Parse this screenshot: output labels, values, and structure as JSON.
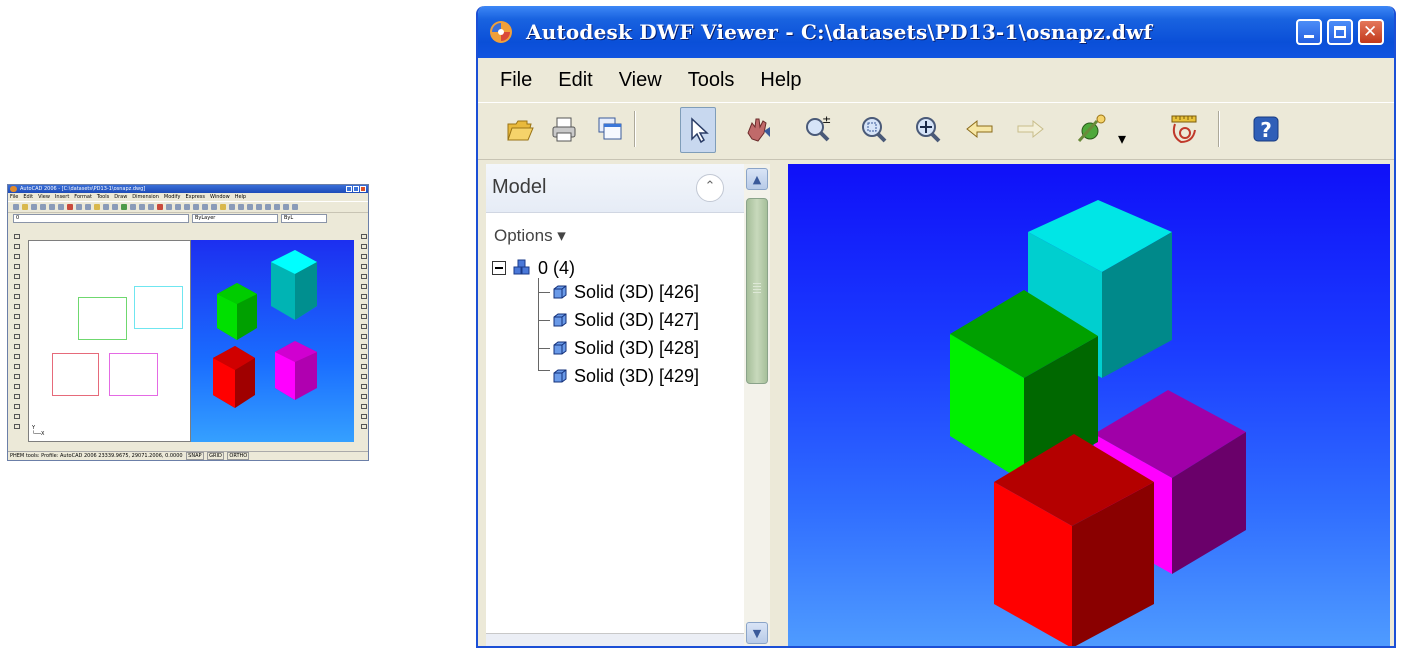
{
  "acad": {
    "title": "AutoCAD 2006 - [C:\\datasets\\PD13-1\\osnapz.dwg]",
    "menu": [
      "File",
      "Edit",
      "View",
      "Insert",
      "Format",
      "Tools",
      "Draw",
      "Dimension",
      "Modify",
      "Express",
      "Window",
      "Help"
    ],
    "layer_value": "0",
    "color_value": "ByLayer",
    "linetype_value": "ByL",
    "status_text": "PHEM tools: Profile: AutoCAD 2006  23339.9675, 29071.2006, 0.0000",
    "status_toggles": [
      "SNAP",
      "GRID",
      "ORTHO"
    ]
  },
  "window": {
    "title": "Autodesk DWF Viewer - C:\\datasets\\PD13-1\\osnapz.dwf"
  },
  "menu": [
    "File",
    "Edit",
    "View",
    "Tools",
    "Help"
  ],
  "toolbar": [
    {
      "icon": "open-folder-icon"
    },
    {
      "icon": "print-icon"
    },
    {
      "icon": "copy-icon"
    },
    {
      "icon": "select-arrow-icon"
    },
    {
      "icon": "pan-hand-icon"
    },
    {
      "icon": "zoom-icon"
    },
    {
      "icon": "zoom-rectangle-icon"
    },
    {
      "icon": "fit-to-window-icon"
    },
    {
      "icon": "back-arrow-icon"
    },
    {
      "icon": "forward-arrow-icon"
    },
    {
      "icon": "orbit-icon"
    },
    {
      "icon": "measure-icon"
    },
    {
      "icon": "help-icon"
    }
  ],
  "panel": {
    "title": "Model",
    "options_label": "Options ▾",
    "tree": {
      "root": "0 (4)",
      "children": [
        "Solid (3D) [426]",
        "Solid (3D) [427]",
        "Solid (3D) [428]",
        "Solid (3D) [429]"
      ]
    }
  },
  "colors": {
    "cyan": "#00e6e6",
    "green": "#00e000",
    "red": "#ff0000",
    "magenta": "#e600e6",
    "viewport_top": "#0f10f8",
    "viewport_bottom": "#4f9cff"
  }
}
